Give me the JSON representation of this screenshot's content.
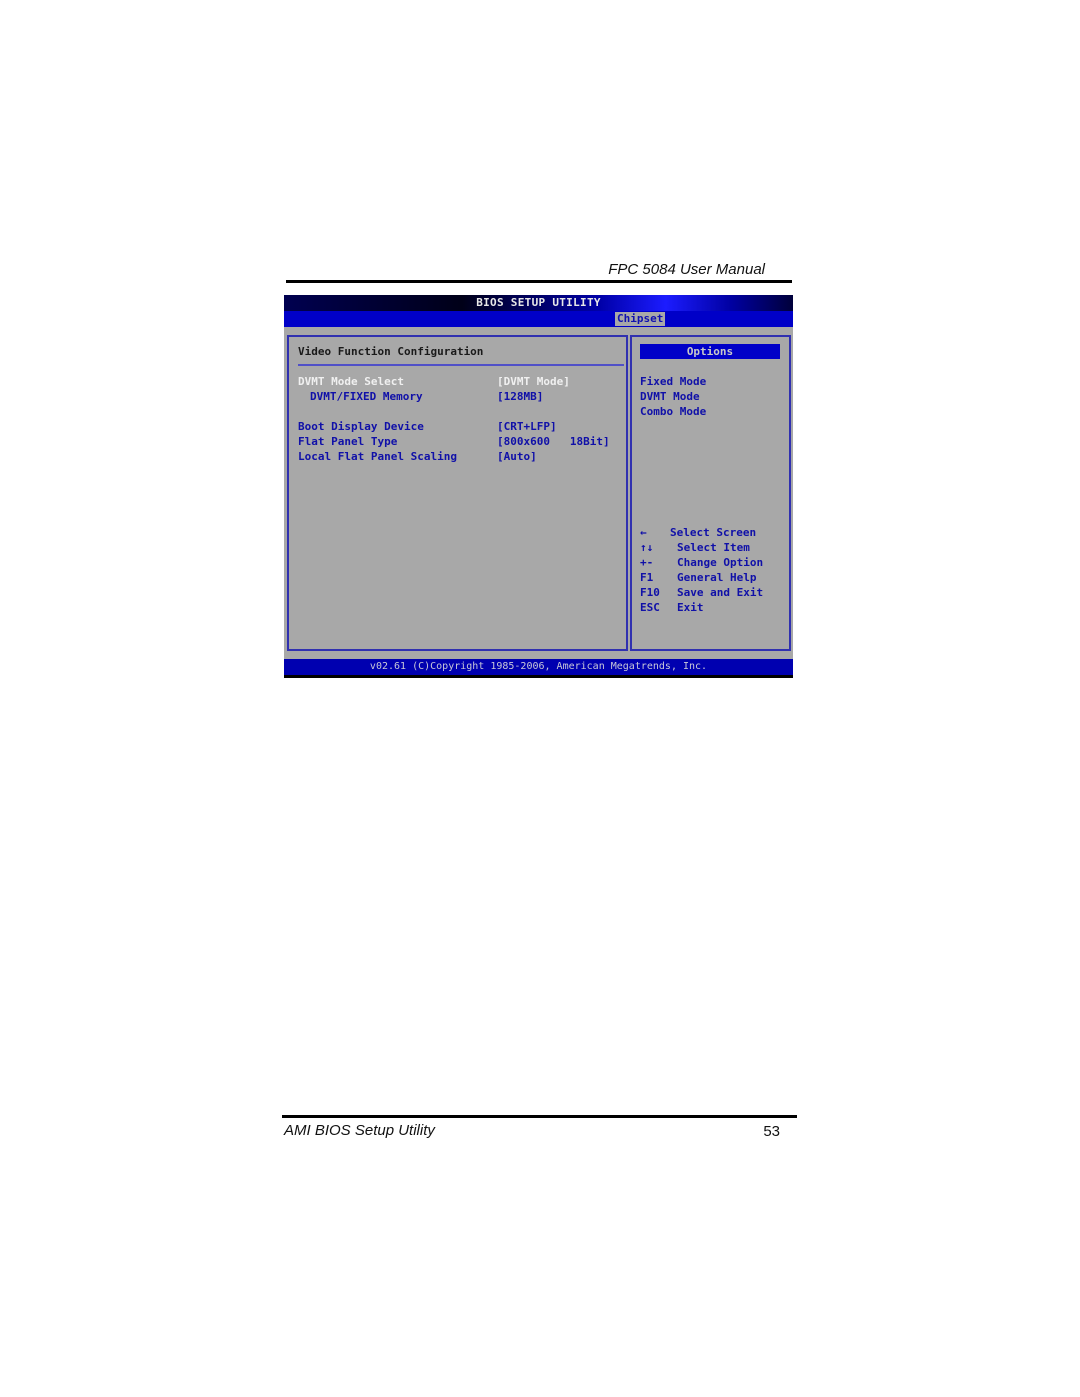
{
  "document": {
    "header_title": "FPC 5084 User Manual",
    "footer_title": "AMI BIOS Setup Utility",
    "page_number": "53"
  },
  "bios": {
    "title": "BIOS SETUP UTILITY",
    "active_tab": "Chipset",
    "section_title": "Video Function Configuration",
    "settings": [
      {
        "label": "DVMT Mode Select",
        "value": "[DVMT Mode]",
        "selected": true,
        "indent": false
      },
      {
        "label": "DVMT/FIXED Memory",
        "value": "[128MB]",
        "selected": false,
        "indent": true
      },
      {
        "label": "Boot Display Device",
        "value": "[CRT+LFP]",
        "selected": false,
        "indent": false
      },
      {
        "label": "Flat Panel Type",
        "value": "[800x600   18Bit]",
        "selected": false,
        "indent": false
      },
      {
        "label": "Local Flat Panel Scaling",
        "value": "[Auto]",
        "selected": false,
        "indent": false
      }
    ],
    "options_header": "Options",
    "options": [
      "Fixed Mode",
      "DVMT Mode",
      "Combo Mode"
    ],
    "help": [
      {
        "key": "←",
        "desc": "Select Screen"
      },
      {
        "key": "↑↓",
        "desc": "Select Item"
      },
      {
        "key": "+-",
        "desc": "Change Option"
      },
      {
        "key": "F1",
        "desc": "General Help"
      },
      {
        "key": "F10",
        "desc": "Save and Exit"
      },
      {
        "key": "ESC",
        "desc": "Exit"
      }
    ],
    "footer": "v02.61 (C)Copyright 1985-2006, American Megatrends, Inc."
  }
}
